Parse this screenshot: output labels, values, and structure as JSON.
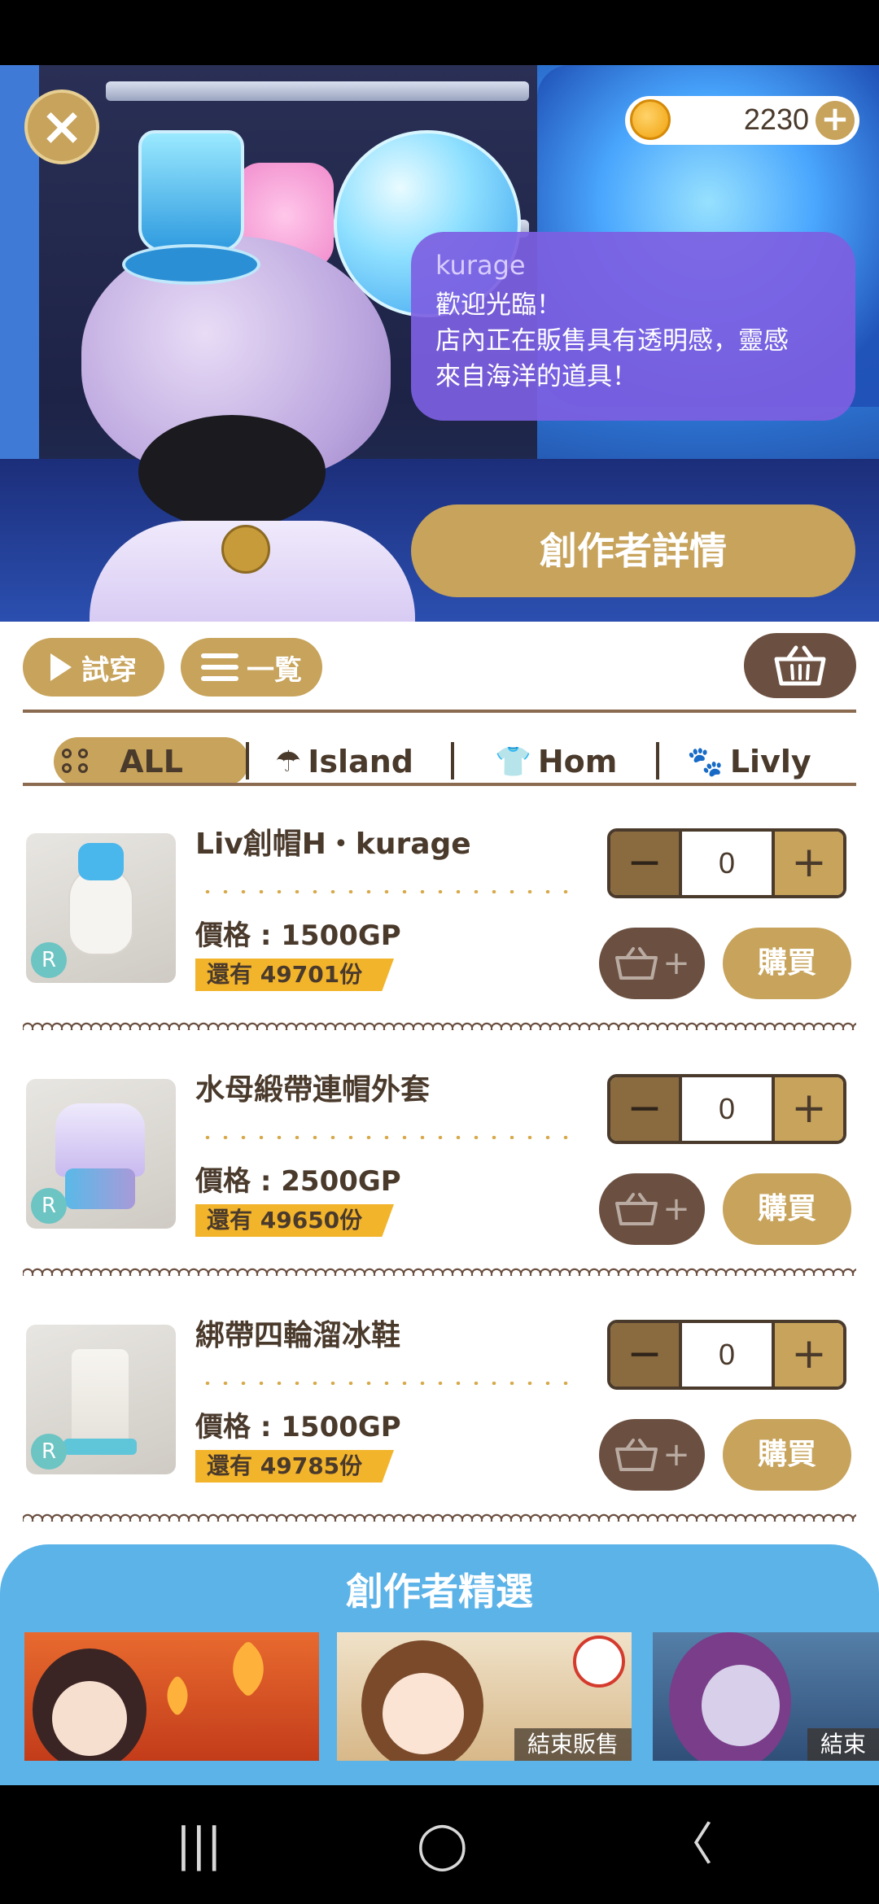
{
  "header": {
    "coins": "2230",
    "close_label": "×",
    "coin_add_label": "+"
  },
  "speech": {
    "name": "kurage",
    "message": "歡迎光臨！\n店內正在販售具有透明感，靈感\n來自海洋的道具！"
  },
  "creator_button": "創作者詳情",
  "toolbar": {
    "try_on": "試穿",
    "list": "一覧"
  },
  "filters": [
    {
      "label": "ALL",
      "icon": "grid-dots-icon",
      "selected": true
    },
    {
      "label": "Island",
      "icon": "island-icon"
    },
    {
      "label": "Hom",
      "icon": "shirt-icon"
    },
    {
      "label": "Livly",
      "icon": "livly-icon"
    }
  ],
  "products": [
    {
      "name": "Liv創帽H・kurage",
      "price": "價格 : 1500GP",
      "stock": "還有 49701份",
      "qty": "0",
      "rarity": "R",
      "buy": "購買"
    },
    {
      "name": "水母緞帶連帽外套",
      "price": "價格 : 2500GP",
      "stock": "還有 49650份",
      "qty": "0",
      "rarity": "R",
      "buy": "購買"
    },
    {
      "name": "綁帶四輪溜冰鞋",
      "price": "價格 : 1500GP",
      "stock": "還有 49785份",
      "qty": "0",
      "rarity": "R",
      "buy": "購買"
    }
  ],
  "stepper": {
    "minus": "−",
    "plus": "+"
  },
  "addcart_plus": "+",
  "picks": {
    "title": "創作者精選",
    "items": [
      {
        "tag": ""
      },
      {
        "tag": "結束販售"
      },
      {
        "tag": "結束"
      }
    ]
  },
  "navbar": {
    "recent": "|||",
    "home": "◯",
    "back": "〈"
  },
  "colors": {
    "accent": "#c7a35b",
    "brown": "#6b5041",
    "stock": "#f2b42b",
    "picks_bg": "#5cb3e8",
    "bubble": "#7d5fe2"
  }
}
